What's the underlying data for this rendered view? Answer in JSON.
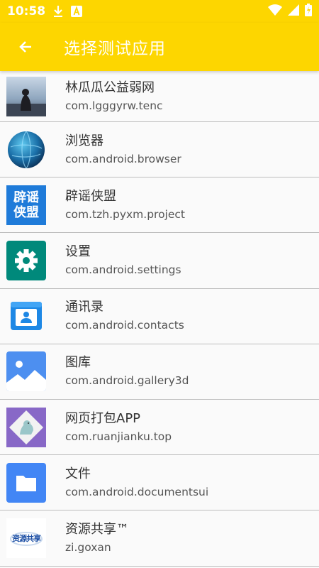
{
  "status_bar": {
    "time": "10:58"
  },
  "toolbar": {
    "title": "选择测试应用"
  },
  "apps": [
    {
      "name": "林瓜瓜公益弱网",
      "package": "com.lgggyrw.tenc"
    },
    {
      "name": "浏览器",
      "package": "com.android.browser"
    },
    {
      "name": "辟谣侠盟",
      "package": "com.tzh.pyxm.project",
      "icon_text": [
        "辟谣",
        "侠盟"
      ]
    },
    {
      "name": "设置",
      "package": "com.android.settings"
    },
    {
      "name": "通讯录",
      "package": "com.android.contacts"
    },
    {
      "name": "图库",
      "package": "com.android.gallery3d"
    },
    {
      "name": "网页打包APP",
      "package": "com.ruanjianku.top"
    },
    {
      "name": "文件",
      "package": "com.android.documentsui"
    },
    {
      "name": "资源共享™",
      "package": "zi.goxan",
      "icon_text": "资源共享"
    }
  ],
  "colors": {
    "accent": "#fdd600",
    "divider": "#bdbdbd"
  }
}
